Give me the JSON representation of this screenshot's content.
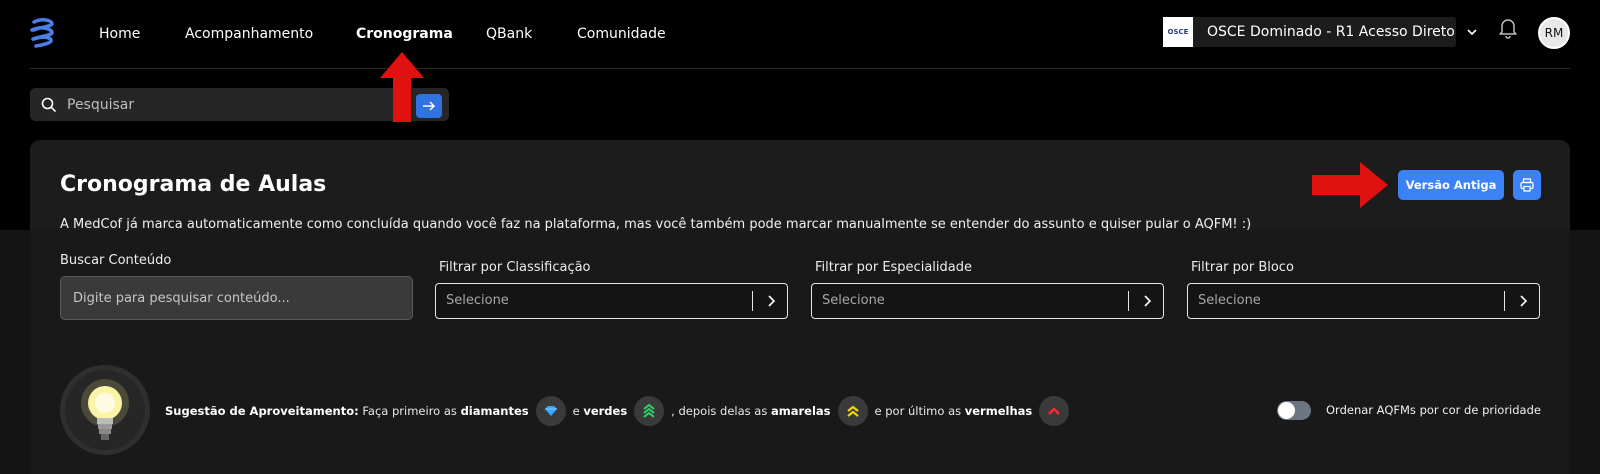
{
  "nav": {
    "links": [
      {
        "label": "Home",
        "active": false
      },
      {
        "label": "Acompanhamento",
        "active": false
      },
      {
        "label": "Cronograma",
        "active": true
      },
      {
        "label": "QBank",
        "active": false
      },
      {
        "label": "Comunidade",
        "active": false
      }
    ],
    "course_name": "OSCE Dominado - R1 Acesso Direto",
    "course_thumb_text": "OSCE",
    "avatar_initials": "RM"
  },
  "search": {
    "placeholder": "Pesquisar"
  },
  "page": {
    "title": "Cronograma de Aulas",
    "subtitle": "A MedCof já marca automaticamente como concluída quando você faz na plataforma, mas você também pode marcar manualmente se entender do assunto e quiser pular o AQFM! :)",
    "old_version_label": "Versão Antiga"
  },
  "filters": {
    "content_label": "Buscar Conteúdo",
    "content_placeholder": "Digite para pesquisar conteúdo...",
    "classification_label": "Filtrar por Classificação",
    "specialty_label": "Filtrar por Especialidade",
    "block_label": "Filtrar por Bloco",
    "select_placeholder": "Selecione"
  },
  "suggestion": {
    "prefix": "Sugestão de Aproveitamento:",
    "t1": "Faça primeiro as",
    "diamonds": "diamantes",
    "t2": "e",
    "greens": "verdes",
    "t3": ", depois delas as",
    "yellows": "amarelas",
    "t4": "e por último as",
    "reds": "vermelhas"
  },
  "toggle": {
    "label": "Ordenar AQFMs por cor de prioridade",
    "on": false
  },
  "colors": {
    "accent": "#3b82f6",
    "annotation_red": "#e0120f"
  }
}
